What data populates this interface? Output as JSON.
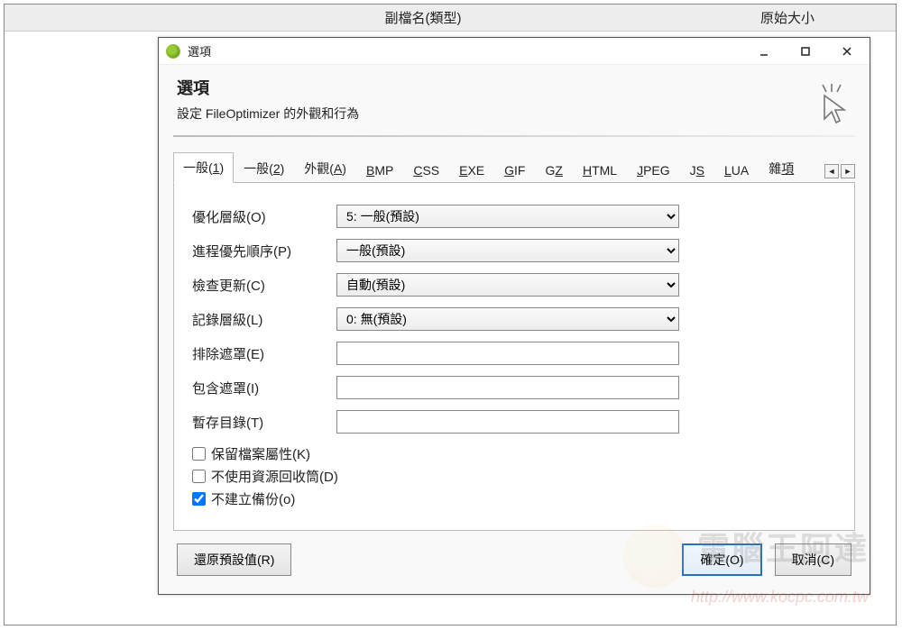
{
  "background": {
    "col_ext": "副檔名(類型)",
    "col_size": "原始大小"
  },
  "dialog": {
    "titlebar": "選項",
    "heading": "選項",
    "subheading": "設定 FileOptimizer 的外觀和行為"
  },
  "tabs": [
    {
      "label": "一般(",
      "accel": "1",
      "tail": ")",
      "active": true
    },
    {
      "label": "一般(",
      "accel": "2",
      "tail": ")"
    },
    {
      "label": "外觀(",
      "accel": "A",
      "tail": ")"
    },
    {
      "label": "",
      "accel": "B",
      "tail": "MP"
    },
    {
      "label": "",
      "accel": "C",
      "tail": "SS"
    },
    {
      "label": "",
      "accel": "E",
      "tail": "XE"
    },
    {
      "label": "",
      "accel": "G",
      "tail": "IF"
    },
    {
      "label": "G",
      "accel": "Z",
      "tail": ""
    },
    {
      "label": "",
      "accel": "H",
      "tail": "TML"
    },
    {
      "label": "",
      "accel": "J",
      "tail": "PEG"
    },
    {
      "label": "J",
      "accel": "S",
      "tail": ""
    },
    {
      "label": "",
      "accel": "L",
      "tail": "UA"
    },
    {
      "label": "雜",
      "accel": "項",
      "tail": ""
    }
  ],
  "form": {
    "opt_level_label": "優化層級(O)",
    "opt_level_value": "5: 一般(預設)",
    "priority_label": "進程優先順序(P)",
    "priority_value": "一般(預設)",
    "update_label": "檢查更新(C)",
    "update_value": "自動(預設)",
    "loglevel_label": "記錄層級(L)",
    "loglevel_value": "0: 無(預設)",
    "exclude_label": "排除遮罩(E)",
    "exclude_value": "",
    "include_label": "包含遮罩(I)",
    "include_value": "",
    "tempdir_label": "暫存目錄(T)",
    "tempdir_value": ""
  },
  "checks": {
    "keep_attr": "保留檔案屬性(K)",
    "keep_attr_checked": false,
    "no_recycle": "不使用資源回收筒(D)",
    "no_recycle_checked": false,
    "no_backup": "不建立備份(o)",
    "no_backup_checked": true
  },
  "buttons": {
    "restore": "還原預設值(R)",
    "ok": "確定(O)",
    "cancel": "取消(C)"
  },
  "watermark": {
    "text": "電腦王阿達",
    "url": "http://www.kocpc.com.tw"
  }
}
